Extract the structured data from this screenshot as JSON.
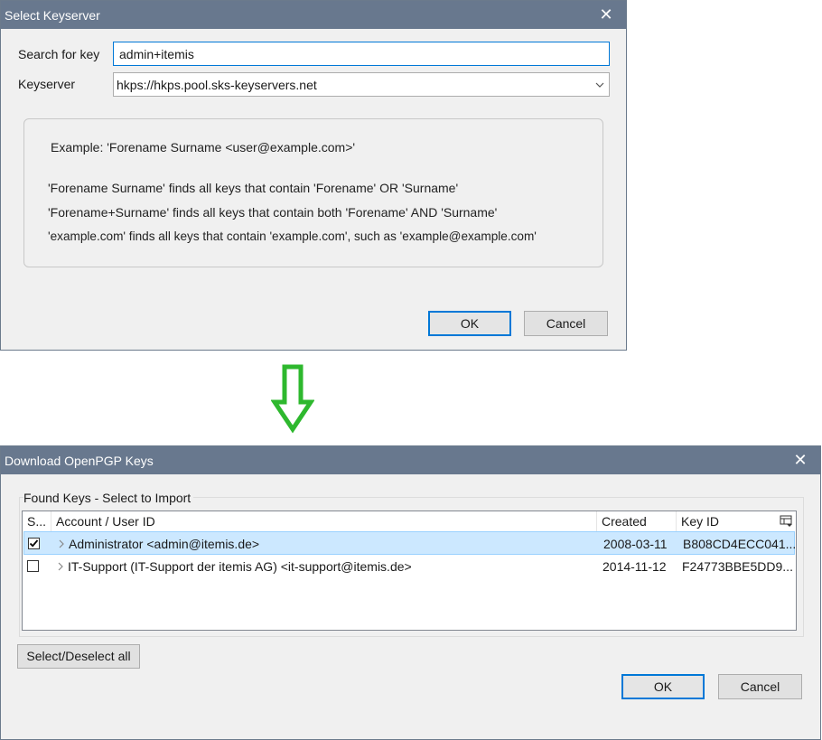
{
  "select_keyserver": {
    "title": "Select Keyserver",
    "search_label": "Search for key",
    "search_value": "admin+itemis",
    "keyserver_label": "Keyserver",
    "keyserver_value": "hkps://hkps.pool.sks-keyservers.net",
    "hints": {
      "example": "Example: 'Forename Surname <user@example.com>'",
      "line1": "'Forename Surname' finds all keys that contain 'Forename' OR 'Surname'",
      "line2": "'Forename+Surname' finds all keys that contain both 'Forename' AND 'Surname'",
      "line3": "'example.com' finds all keys that contain 'example.com', such as 'example@example.com'"
    },
    "ok_label": "OK",
    "cancel_label": "Cancel"
  },
  "download_keys": {
    "title": "Download OpenPGP Keys",
    "group_label": "Found Keys - Select to Import",
    "columns": {
      "select": "S...",
      "account": "Account / User ID",
      "created": "Created",
      "key_id": "Key ID"
    },
    "rows": [
      {
        "selected": true,
        "account": "Administrator <admin@itemis.de>",
        "created": "2008-03-11",
        "key_id": "B808CD4ECC041..."
      },
      {
        "selected": false,
        "account": "IT-Support (IT-Support der itemis AG) <it-support@itemis.de>",
        "created": "2014-11-12",
        "key_id": "F24773BBE5DD9..."
      }
    ],
    "select_all_label": "Select/Deselect all",
    "ok_label": "OK",
    "cancel_label": "Cancel"
  },
  "colors": {
    "titlebar": "#68788e",
    "arrow": "#2eb82e",
    "selection": "#cce8ff",
    "accent": "#0078d7"
  },
  "icons": {
    "close": "close-icon",
    "dropdown": "chevron-down-icon",
    "arrow": "down-arrow-icon",
    "expander": "chevron-right-icon",
    "column_picker": "column-picker-icon"
  }
}
